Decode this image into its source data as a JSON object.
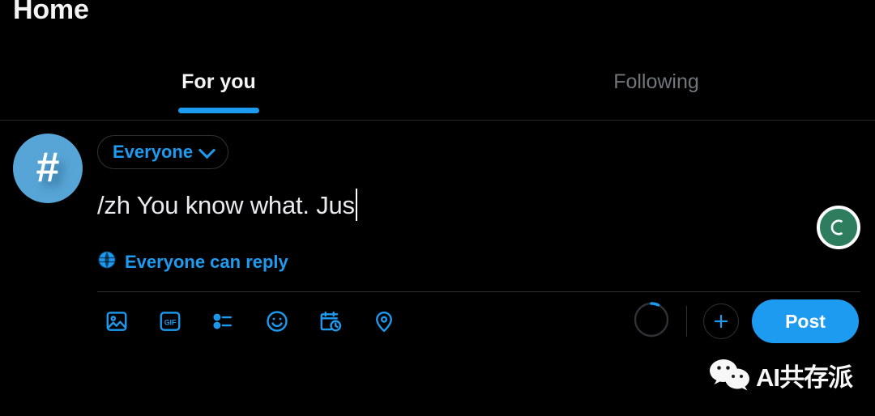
{
  "header": {
    "title": "Home"
  },
  "tabs": [
    {
      "label": "For you",
      "active": true,
      "name": "tab-for-you"
    },
    {
      "label": "Following",
      "active": false,
      "name": "tab-following"
    }
  ],
  "composer": {
    "avatar": {
      "icon": "hashtag-icon",
      "glyph": "#",
      "color": "#57a5d6"
    },
    "audience": {
      "label": "Everyone",
      "icon": "chevron-down-icon"
    },
    "tweet_text": "/zh You know what. Jus",
    "caret_visible": true,
    "reply_scope": {
      "label": "Everyone can reply",
      "icon": "globe-icon"
    },
    "toolbar": [
      {
        "name": "media-icon",
        "label": "Media"
      },
      {
        "name": "gif-icon",
        "label": "GIF"
      },
      {
        "name": "poll-icon",
        "label": "Poll"
      },
      {
        "name": "emoji-icon",
        "label": "Emoji"
      },
      {
        "name": "schedule-icon",
        "label": "Schedule"
      },
      {
        "name": "location-icon",
        "label": "Location"
      }
    ],
    "progress": {
      "name": "character-count-ring",
      "percent": 8
    },
    "add_button": {
      "label": "+",
      "name": "add-post-icon"
    },
    "post_button": {
      "label": "Post"
    }
  },
  "status_avatar": {
    "name": "status-avatar",
    "color": "#2e7d5f"
  },
  "watermark": {
    "text": "AI共存派",
    "icon": "wechat-logo-icon"
  },
  "colors": {
    "background": "#000000",
    "accent": "#1d9bf0",
    "text_primary": "#e7e9ea",
    "text_muted": "#71767b",
    "border": "#2f3336"
  }
}
